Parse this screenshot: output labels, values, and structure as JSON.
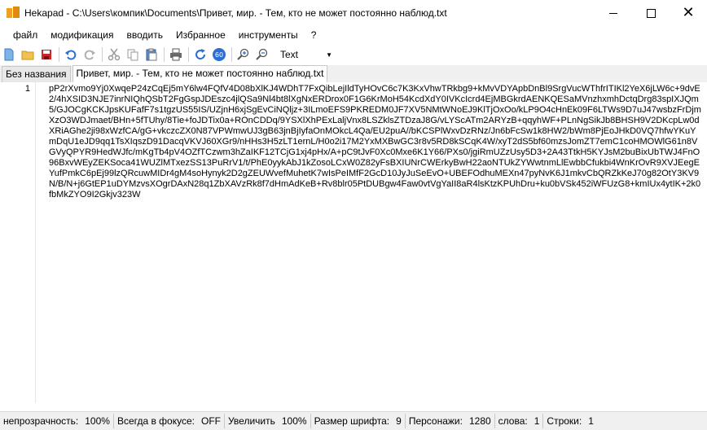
{
  "window": {
    "title": "Hekapad - C:\\Users\\компик\\Documents\\Привет, мир.  - Тем, кто не может постоянно наблюд.txt"
  },
  "menu": [
    "файл",
    "модификация",
    "вводить",
    "Избранное",
    "инструменты",
    "?"
  ],
  "toolbar": {
    "zoom_badge": "60",
    "font_value": "Text"
  },
  "tabs": [
    "Без названия",
    "Привет, мир.  - Тем, кто не может постоянно наблюд.txt"
  ],
  "editor": {
    "line_number": "1",
    "content": "pP2rXvmo9Yj0XwqeP24zCqEj5mY6lw4FQfV4D08bXlKJ4WDhT7FxQibLejIldTyHOvC6c7K3KxVhwTRkbg9+kMvVDYApbDnBl9SrgVucWThfrITIKl2YeX6jLW6c+9dvE2/4hXSID3NJE7inrNIQhQSbT2FgGspJDEszc4jlQSa9Nl4bt8lXgNxERDrox0F1G6KrMoH54KcdXdY0IVKcIcrd4EjMBGkrdAENKQESaMVnzhxmhDctqDrg83spIXJQm5/GJOCgKCKJpsKUFafF7s1tgzUS55IS/UZjnH6xjSgEvCiNQljz+3ILmoEFS9PKREDM0JF7XV5NMtWNoEJ9KlTjOxOo/kLP9O4cHnEk09F6LTWs9D7uJ47wsbzFrDjmXzO3WDJmaet/BHn+5fTUhy/8Tie+foJDTix0a+ROnCDDq/9YSXlXhPExLaljVnx8LSZklsZTDzaJ8G/vLYScATm2ARYzB+qqyhWF+PLnNgSikJb8BHSH9V2DKcpLw0dXRiAGhe2ji98xWzfCA/gG+vkczcZX0N87VPWmwUJ3gB63jnBjIyfaOnMOkcL4Qa/EU2puA//bKCSPlWxvDzRNz/Jn6bFcSw1k8HW2/bWm8PjEoJHkD0VQ7hfwYKuYmDqU1eJD9qq1TsXIqszD91DacqVKVJ60XGr9/nHHs3H5zLT1ernL/H0o2i17M2YxMXBwGC3r8v5RD8kSCqK4W/xyT2dS5bf60mzsJomZT7emC1coHMOWlG61n8VGVyQPYR9HedWJfc/mKgTb4pV4OZfTCzwm3hZaIKF12TCjG1xj4pHx/A+pC9tJvF0Xc0Mxe6K1Y66/PXs0/jgiRmUZzUsy5D3+2A43TtkH5KYJsM2buBixUbTWJ4FnO96BxvWEyZEKSoca41WUZlMTxezSS13PuRrV1/t/PhE0yykAbJ1kZosoLCxW0Z82yFsBXIUNrCWErkyBwH22aoNTUkZYWwtnmLlEwbbCfukbi4WnKrOvR9XVJEegEYufPmkC6pEj99lzQRcuwMIDr4gM4soHynyk2D2gZEUWvefMuhetK7wIsPeIMfF2GcD10JyJuSeEvO+UBEFOdhuMEXn47pyNvK6J1mkvCbQRZkKeJ70g82OtY3KV9N/B/N+j6GtEP1uDYMzvsXOgrDAxN28q1ZbXAVzRk8f7dHmAdKeB+Rv8blr05PtDUBgw4Faw0vtVgYaII8aR4lsKtzKPUhDru+ku0bVSk452iWFUzG8+kmIUx4ytIK+2k0fbMkZYO9I2Gkjv323W"
  },
  "status": [
    {
      "label": "непрозрачность:",
      "value": "100%"
    },
    {
      "label": "Всегда в фокусе:",
      "value": "OFF"
    },
    {
      "label": "Увеличить",
      "value": "100%"
    },
    {
      "label": "Размер шрифта:",
      "value": "9"
    },
    {
      "label": "Персонажи:",
      "value": "1280"
    },
    {
      "label": "слова:",
      "value": "1"
    },
    {
      "label": "Строки:",
      "value": "1"
    }
  ],
  "colors": {
    "accent_blue": "#2a6fd6",
    "icon_orange": "#e8a020",
    "icon_red": "#c82828"
  }
}
